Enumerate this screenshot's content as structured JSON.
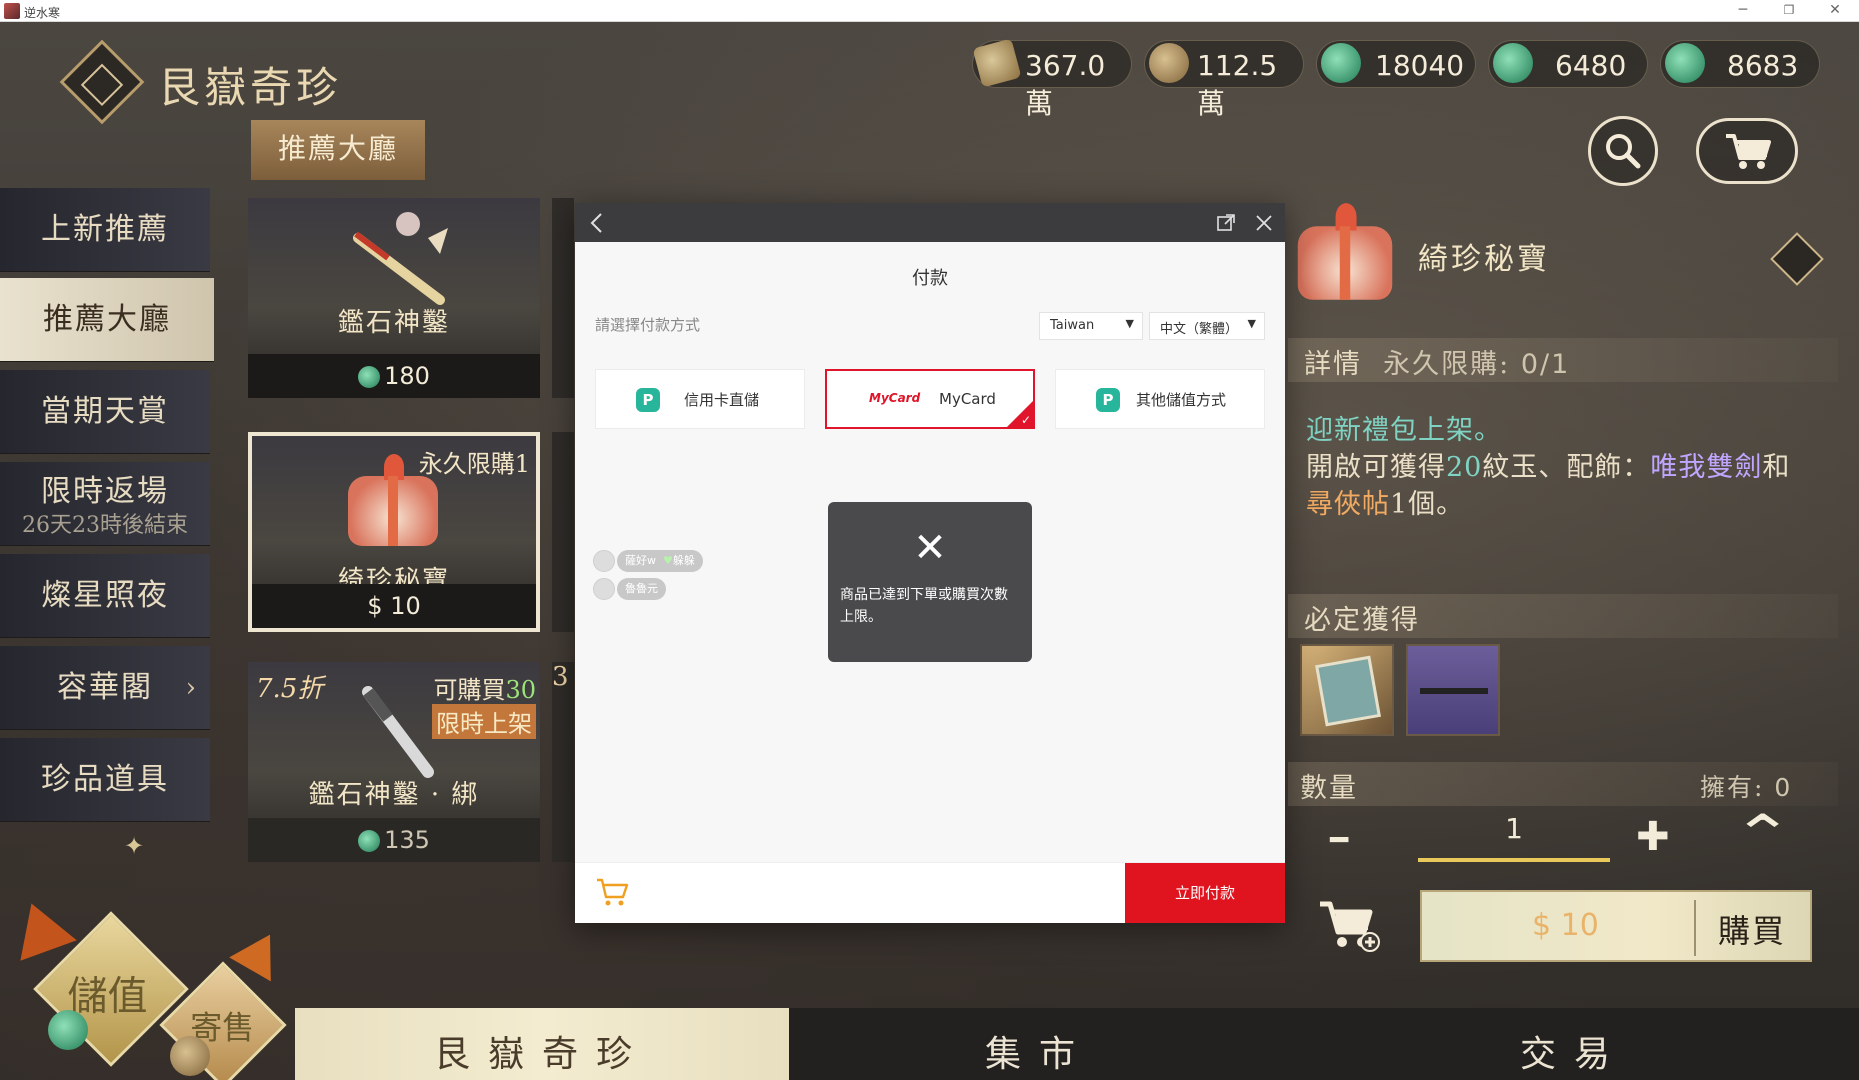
{
  "window": {
    "title": "逆水寒",
    "controls": {
      "minimize": "─",
      "restore": "❐",
      "close": "✕"
    }
  },
  "shop": {
    "title": "艮嶽奇珍"
  },
  "currencies": [
    {
      "icon": "scroll-icon",
      "value": "367.0萬"
    },
    {
      "icon": "coin-icon",
      "value": "112.5萬"
    },
    {
      "icon": "jade-icon",
      "value": "18040"
    },
    {
      "icon": "jade-icon",
      "value": "6480"
    },
    {
      "icon": "jade-icon",
      "value": "8683"
    }
  ],
  "top_tab": {
    "label": "推薦大廳"
  },
  "sidebar": {
    "items": [
      {
        "label": "上新推薦"
      },
      {
        "label": "推薦大廳",
        "active": true
      },
      {
        "label": "當期天賞"
      },
      {
        "label": "限時返場",
        "sub": "26天23時後結束"
      },
      {
        "label": "燦星照夜"
      },
      {
        "label": "容華閣",
        "arrow": "›"
      },
      {
        "label": "珍品道具"
      }
    ],
    "sparkle": "✦"
  },
  "cards": [
    {
      "name": "鑑石神鑿",
      "price": "180"
    },
    {
      "name": "綺珍秘寶",
      "price": "10",
      "currency_symbol": "$",
      "corner": "永久限購1",
      "selected": true
    },
    {
      "name": "鑑石神鑿 · 綁",
      "price": "135",
      "discount": "7.5折",
      "limit": "可購買",
      "limit_count": "30",
      "tag": "限時上架",
      "next_peek": "3"
    }
  ],
  "modal": {
    "title": "付款",
    "prompt": "請選擇付款方式",
    "region": "Taiwan",
    "language": "中文（繁體）",
    "methods": [
      {
        "label": "信用卡直儲"
      },
      {
        "label": "MyCard",
        "logo": "MyCard",
        "active": true
      },
      {
        "label": "其他儲值方式"
      }
    ],
    "chips": [
      {
        "name": "薩好w",
        "tag": "躲躲"
      },
      {
        "name": "魯魯元"
      }
    ],
    "toast": {
      "message": "商品已達到下單或購買次數上限。"
    },
    "pay_button": "立即付款"
  },
  "detail": {
    "name": "綺珍秘寶",
    "info_label": "詳情",
    "limit_label": "永久限購:",
    "limit_value": "0/1",
    "desc_line1": "迎新禮包上架。",
    "desc_pre": "開啟可獲得",
    "desc_num": "20",
    "desc_item": "紋玉、配飾：",
    "desc_acc": "唯我雙劍",
    "desc_and": "和",
    "desc_ticket": "尋俠帖",
    "desc_tail": "1個。",
    "guaranteed_label": "必定獲得",
    "qty_label": "數量",
    "owned_label": "擁有:",
    "owned_value": "0",
    "qty_value": "1",
    "minus": "━",
    "plus": "✚",
    "max": "⌃",
    "buy_price_symbol": "$",
    "buy_price": "10",
    "buy_label": "購買"
  },
  "bottom_tabs": [
    {
      "label": "艮嶽奇珍",
      "active": true
    },
    {
      "label": "集市"
    },
    {
      "label": "交易"
    }
  ],
  "corner_buttons": {
    "topup": "儲值",
    "consign": "寄售"
  },
  "colors": {
    "accent_red": "#e0141e",
    "gold": "#e9c95a",
    "mycard_red": "#e0142a",
    "pay_green": "#27b59b"
  }
}
